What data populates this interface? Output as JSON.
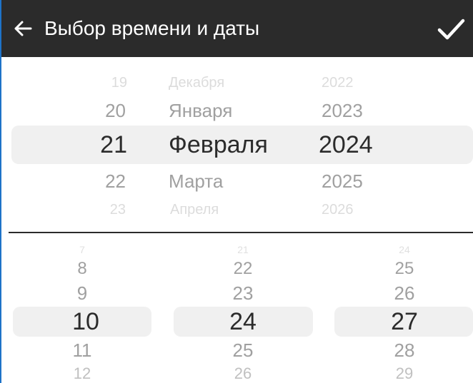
{
  "header": {
    "title": "Выбор времени и даты",
    "back_icon": "arrow-left-icon",
    "confirm_icon": "checkmark-icon"
  },
  "date_picker": {
    "days": [
      "19",
      "20",
      "21",
      "22",
      "23"
    ],
    "months": [
      "Декабря",
      "Января",
      "Февраля",
      "Марта",
      "Апреля"
    ],
    "years": [
      "2022",
      "2023",
      "2024",
      "2025",
      "2026"
    ],
    "selected": {
      "day": "21",
      "month": "Февраля",
      "year": "2024"
    }
  },
  "time_picker": {
    "col1": [
      "7",
      "8",
      "9",
      "10",
      "11",
      "12"
    ],
    "col2": [
      "21",
      "22",
      "23",
      "24",
      "25",
      "26"
    ],
    "col3": [
      "24",
      "25",
      "26",
      "27",
      "28",
      "29"
    ],
    "selected": {
      "col1": "10",
      "col2": "24",
      "col3": "27"
    }
  },
  "colors": {
    "header_bg": "#2b2b2b",
    "selection_band": "#f0f0f0",
    "text_selected": "#2b2b2b",
    "text_faded": "#a0a0a0"
  }
}
